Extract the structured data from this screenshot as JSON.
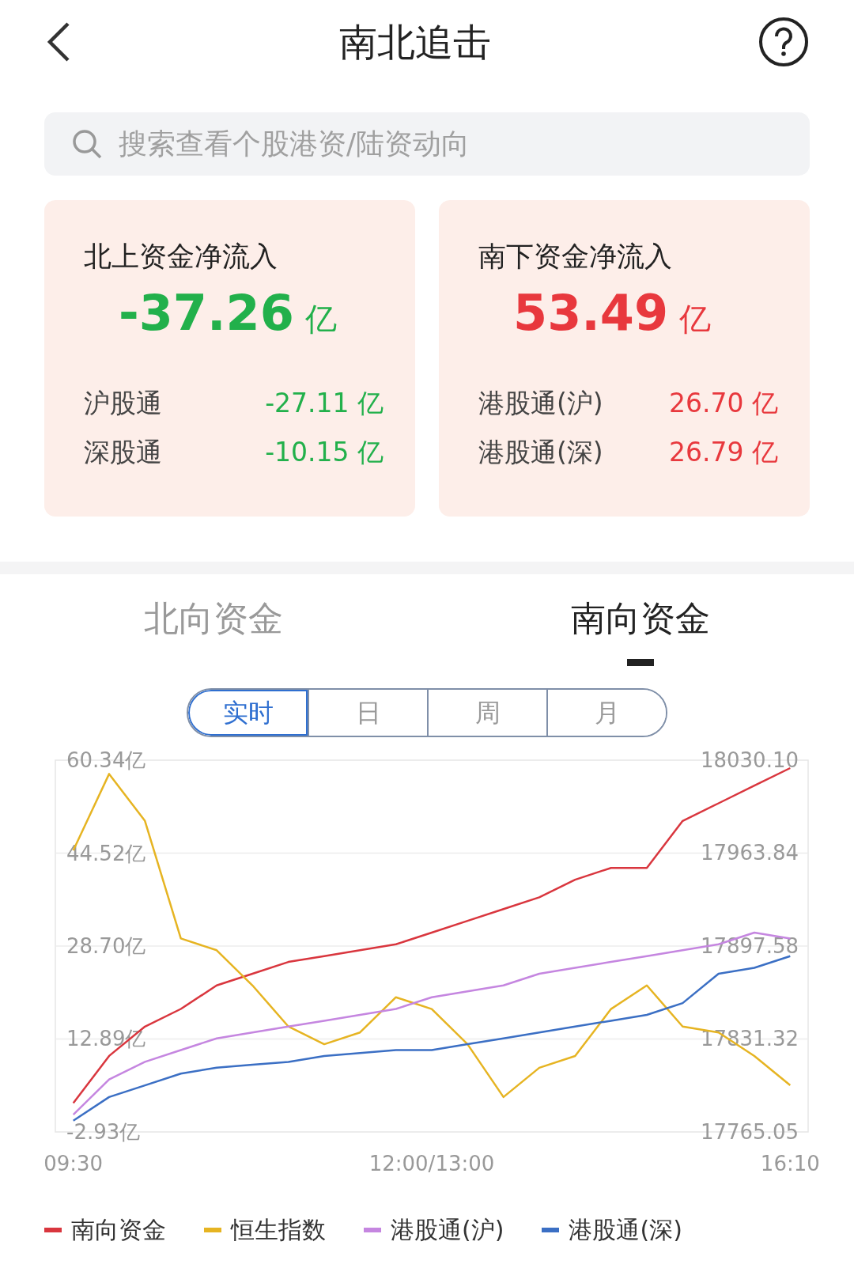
{
  "header": {
    "title": "南北追击"
  },
  "search": {
    "placeholder": "搜索查看个股港资/陆资动向"
  },
  "summary_cards": [
    {
      "title": "北上资金净流入",
      "value": "-37.26",
      "unit": "亿",
      "color": "#22b04b",
      "rows": [
        {
          "label": "沪股通",
          "value": "-27.11",
          "unit": "亿"
        },
        {
          "label": "深股通",
          "value": "-10.15",
          "unit": "亿"
        }
      ]
    },
    {
      "title": "南下资金净流入",
      "value": "53.49",
      "unit": "亿",
      "color": "#e8383d",
      "rows": [
        {
          "label": "港股通(沪)",
          "value": "26.70",
          "unit": "亿"
        },
        {
          "label": "港股通(深)",
          "value": "26.79",
          "unit": "亿"
        }
      ]
    }
  ],
  "flow_tabs": [
    {
      "label": "北向资金",
      "selected": false
    },
    {
      "label": "南向资金",
      "selected": true
    }
  ],
  "period_tabs": [
    {
      "label": "实时",
      "selected": true
    },
    {
      "label": "日",
      "selected": false
    },
    {
      "label": "周",
      "selected": false
    },
    {
      "label": "月",
      "selected": false
    }
  ],
  "chart": {
    "chart_data": {
      "type": "line",
      "categories": [
        "09:30",
        null,
        null,
        null,
        null,
        null,
        null,
        null,
        null,
        null,
        "12:00/13:00",
        null,
        null,
        null,
        null,
        null,
        null,
        null,
        null,
        null,
        "16:10"
      ],
      "grid": true,
      "ylim": [
        -2.93,
        60.34
      ],
      "yticks": [
        {
          "value": 60.34,
          "label": "60.34亿"
        },
        {
          "value": 44.52,
          "label": "44.52亿"
        },
        {
          "value": 28.7,
          "label": "28.70亿"
        },
        {
          "value": 12.89,
          "label": "12.89亿"
        },
        {
          "value": -2.93,
          "label": "-2.93亿"
        }
      ],
      "y2lim": [
        17765.05,
        18030.1
      ],
      "y2ticks": [
        {
          "value": 18030.1,
          "label": "18030.10"
        },
        {
          "value": 17963.84,
          "label": "17963.84"
        },
        {
          "value": 17897.58,
          "label": "17897.58"
        },
        {
          "value": 17831.32,
          "label": "17831.32"
        },
        {
          "value": 17765.05,
          "label": "17765.05"
        }
      ],
      "series": [
        {
          "name": "南向资金",
          "color": "#d9363e",
          "values": [
            2,
            10,
            15,
            18,
            22,
            24,
            26,
            27,
            28,
            29,
            31,
            33,
            35,
            37,
            40,
            42,
            42,
            50,
            53,
            56,
            59
          ]
        },
        {
          "name": "恒生指数",
          "color": "#e6b422",
          "axis": "y2",
          "values": [
            17965.8,
            18020.3,
            17986.8,
            17903.0,
            17894.6,
            17869.5,
            17840.2,
            17827.6,
            17836.0,
            17861.1,
            17852.7,
            17827.6,
            17789.9,
            17810.8,
            17819.2,
            17852.7,
            17869.5,
            17840.2,
            17836.0,
            17819.2,
            17798.3
          ]
        },
        {
          "name": "港股通(沪)",
          "color": "#c586e0",
          "values": [
            0,
            6,
            9,
            11,
            13,
            14,
            15,
            16,
            17,
            18,
            20,
            21,
            22,
            24,
            25,
            26,
            27,
            28,
            29,
            31,
            30
          ]
        },
        {
          "name": "港股通(深)",
          "color": "#3b6fc4",
          "values": [
            -1,
            3,
            5,
            7,
            8,
            8.5,
            9,
            10,
            10.5,
            11,
            11,
            12,
            13,
            14,
            15,
            16,
            17,
            19,
            24,
            25,
            27
          ]
        }
      ]
    }
  }
}
